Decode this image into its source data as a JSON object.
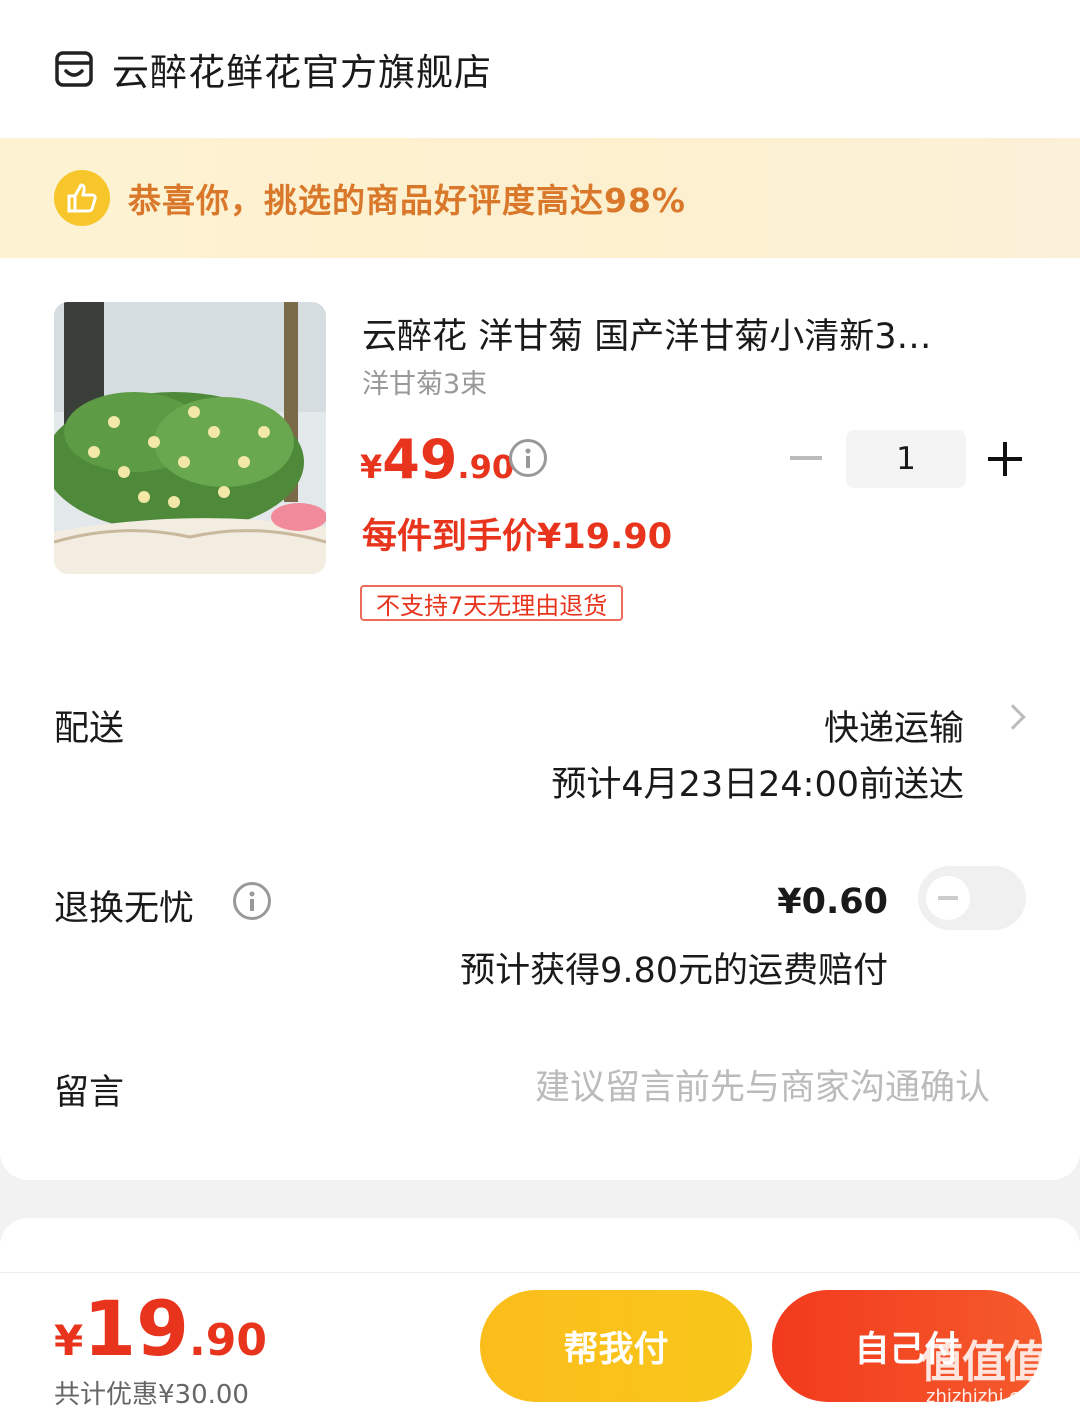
{
  "store": {
    "name": "云醉花鲜花官方旗舰店",
    "icon": "store-icon"
  },
  "banner": {
    "text": "恭喜你，挑选的商品好评度高达98%",
    "icon": "thumbs-up-icon"
  },
  "product": {
    "title": "云醉花 洋甘菊 国产洋甘菊小清新3…",
    "spec": "洋甘菊3束",
    "price_symbol": "¥",
    "price_int": "49",
    "price_dec": ".90",
    "final_price": "每件到手价¥19.90",
    "tag": "不支持7天无理由退货",
    "quantity": "1"
  },
  "delivery": {
    "label": "配送",
    "method": "快递运输",
    "eta": "预计4月23日24:00前送达"
  },
  "insurance": {
    "label": "退换无忧",
    "price": "¥0.60",
    "note": "预计获得9.80元的运费赔付",
    "enabled": false
  },
  "message": {
    "label": "留言",
    "placeholder": "建议留言前先与商家沟通确认"
  },
  "footer": {
    "total_symbol": "¥",
    "total_int": "19",
    "total_dec": ".90",
    "saving": "共计优惠¥30.00",
    "help_pay": "帮我付",
    "self_pay": "自己付",
    "watermark": "值值值",
    "watermark_sub": "zhizhizhi.com"
  },
  "colors": {
    "accent_red": "#e8341c",
    "banner_orange": "#d9782a",
    "yellow_button": "#fbbd1b"
  }
}
